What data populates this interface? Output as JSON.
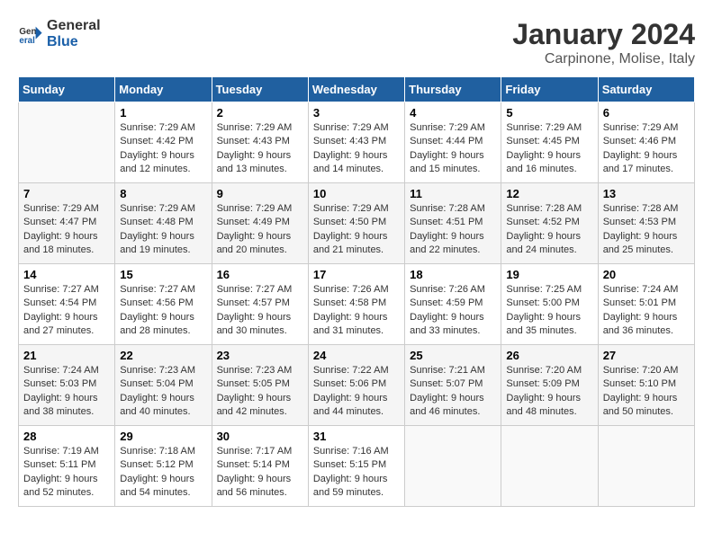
{
  "header": {
    "logo_line1": "General",
    "logo_line2": "Blue",
    "month": "January 2024",
    "location": "Carpinone, Molise, Italy"
  },
  "days_of_week": [
    "Sunday",
    "Monday",
    "Tuesday",
    "Wednesday",
    "Thursday",
    "Friday",
    "Saturday"
  ],
  "weeks": [
    [
      {
        "day": "",
        "sunrise": "",
        "sunset": "",
        "daylight": ""
      },
      {
        "day": "1",
        "sunrise": "Sunrise: 7:29 AM",
        "sunset": "Sunset: 4:42 PM",
        "daylight": "Daylight: 9 hours and 12 minutes."
      },
      {
        "day": "2",
        "sunrise": "Sunrise: 7:29 AM",
        "sunset": "Sunset: 4:43 PM",
        "daylight": "Daylight: 9 hours and 13 minutes."
      },
      {
        "day": "3",
        "sunrise": "Sunrise: 7:29 AM",
        "sunset": "Sunset: 4:43 PM",
        "daylight": "Daylight: 9 hours and 14 minutes."
      },
      {
        "day": "4",
        "sunrise": "Sunrise: 7:29 AM",
        "sunset": "Sunset: 4:44 PM",
        "daylight": "Daylight: 9 hours and 15 minutes."
      },
      {
        "day": "5",
        "sunrise": "Sunrise: 7:29 AM",
        "sunset": "Sunset: 4:45 PM",
        "daylight": "Daylight: 9 hours and 16 minutes."
      },
      {
        "day": "6",
        "sunrise": "Sunrise: 7:29 AM",
        "sunset": "Sunset: 4:46 PM",
        "daylight": "Daylight: 9 hours and 17 minutes."
      }
    ],
    [
      {
        "day": "7",
        "sunrise": "Sunrise: 7:29 AM",
        "sunset": "Sunset: 4:47 PM",
        "daylight": "Daylight: 9 hours and 18 minutes."
      },
      {
        "day": "8",
        "sunrise": "Sunrise: 7:29 AM",
        "sunset": "Sunset: 4:48 PM",
        "daylight": "Daylight: 9 hours and 19 minutes."
      },
      {
        "day": "9",
        "sunrise": "Sunrise: 7:29 AM",
        "sunset": "Sunset: 4:49 PM",
        "daylight": "Daylight: 9 hours and 20 minutes."
      },
      {
        "day": "10",
        "sunrise": "Sunrise: 7:29 AM",
        "sunset": "Sunset: 4:50 PM",
        "daylight": "Daylight: 9 hours and 21 minutes."
      },
      {
        "day": "11",
        "sunrise": "Sunrise: 7:28 AM",
        "sunset": "Sunset: 4:51 PM",
        "daylight": "Daylight: 9 hours and 22 minutes."
      },
      {
        "day": "12",
        "sunrise": "Sunrise: 7:28 AM",
        "sunset": "Sunset: 4:52 PM",
        "daylight": "Daylight: 9 hours and 24 minutes."
      },
      {
        "day": "13",
        "sunrise": "Sunrise: 7:28 AM",
        "sunset": "Sunset: 4:53 PM",
        "daylight": "Daylight: 9 hours and 25 minutes."
      }
    ],
    [
      {
        "day": "14",
        "sunrise": "Sunrise: 7:27 AM",
        "sunset": "Sunset: 4:54 PM",
        "daylight": "Daylight: 9 hours and 27 minutes."
      },
      {
        "day": "15",
        "sunrise": "Sunrise: 7:27 AM",
        "sunset": "Sunset: 4:56 PM",
        "daylight": "Daylight: 9 hours and 28 minutes."
      },
      {
        "day": "16",
        "sunrise": "Sunrise: 7:27 AM",
        "sunset": "Sunset: 4:57 PM",
        "daylight": "Daylight: 9 hours and 30 minutes."
      },
      {
        "day": "17",
        "sunrise": "Sunrise: 7:26 AM",
        "sunset": "Sunset: 4:58 PM",
        "daylight": "Daylight: 9 hours and 31 minutes."
      },
      {
        "day": "18",
        "sunrise": "Sunrise: 7:26 AM",
        "sunset": "Sunset: 4:59 PM",
        "daylight": "Daylight: 9 hours and 33 minutes."
      },
      {
        "day": "19",
        "sunrise": "Sunrise: 7:25 AM",
        "sunset": "Sunset: 5:00 PM",
        "daylight": "Daylight: 9 hours and 35 minutes."
      },
      {
        "day": "20",
        "sunrise": "Sunrise: 7:24 AM",
        "sunset": "Sunset: 5:01 PM",
        "daylight": "Daylight: 9 hours and 36 minutes."
      }
    ],
    [
      {
        "day": "21",
        "sunrise": "Sunrise: 7:24 AM",
        "sunset": "Sunset: 5:03 PM",
        "daylight": "Daylight: 9 hours and 38 minutes."
      },
      {
        "day": "22",
        "sunrise": "Sunrise: 7:23 AM",
        "sunset": "Sunset: 5:04 PM",
        "daylight": "Daylight: 9 hours and 40 minutes."
      },
      {
        "day": "23",
        "sunrise": "Sunrise: 7:23 AM",
        "sunset": "Sunset: 5:05 PM",
        "daylight": "Daylight: 9 hours and 42 minutes."
      },
      {
        "day": "24",
        "sunrise": "Sunrise: 7:22 AM",
        "sunset": "Sunset: 5:06 PM",
        "daylight": "Daylight: 9 hours and 44 minutes."
      },
      {
        "day": "25",
        "sunrise": "Sunrise: 7:21 AM",
        "sunset": "Sunset: 5:07 PM",
        "daylight": "Daylight: 9 hours and 46 minutes."
      },
      {
        "day": "26",
        "sunrise": "Sunrise: 7:20 AM",
        "sunset": "Sunset: 5:09 PM",
        "daylight": "Daylight: 9 hours and 48 minutes."
      },
      {
        "day": "27",
        "sunrise": "Sunrise: 7:20 AM",
        "sunset": "Sunset: 5:10 PM",
        "daylight": "Daylight: 9 hours and 50 minutes."
      }
    ],
    [
      {
        "day": "28",
        "sunrise": "Sunrise: 7:19 AM",
        "sunset": "Sunset: 5:11 PM",
        "daylight": "Daylight: 9 hours and 52 minutes."
      },
      {
        "day": "29",
        "sunrise": "Sunrise: 7:18 AM",
        "sunset": "Sunset: 5:12 PM",
        "daylight": "Daylight: 9 hours and 54 minutes."
      },
      {
        "day": "30",
        "sunrise": "Sunrise: 7:17 AM",
        "sunset": "Sunset: 5:14 PM",
        "daylight": "Daylight: 9 hours and 56 minutes."
      },
      {
        "day": "31",
        "sunrise": "Sunrise: 7:16 AM",
        "sunset": "Sunset: 5:15 PM",
        "daylight": "Daylight: 9 hours and 59 minutes."
      },
      {
        "day": "",
        "sunrise": "",
        "sunset": "",
        "daylight": ""
      },
      {
        "day": "",
        "sunrise": "",
        "sunset": "",
        "daylight": ""
      },
      {
        "day": "",
        "sunrise": "",
        "sunset": "",
        "daylight": ""
      }
    ]
  ]
}
